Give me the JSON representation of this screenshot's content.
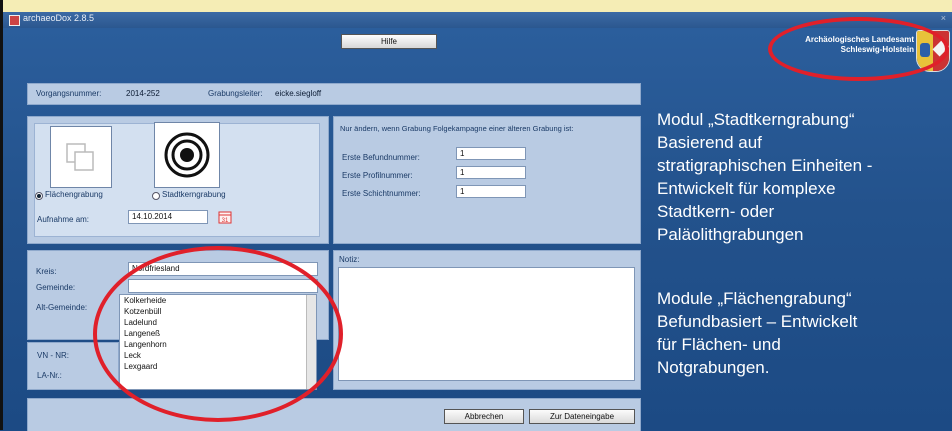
{
  "window": {
    "app_title": "archaeoDox 2.8.5",
    "close_glyph": "×"
  },
  "toolbar": {
    "help_label": "Hilfe"
  },
  "logo": {
    "line1": "Archäologisches Landesamt",
    "line2": "Schleswig-Holstein",
    "crest_icon": "coat-of-arms-icon"
  },
  "header": {
    "vorgang_label": "Vorgangsnummer:",
    "vorgang_value": "2014-252",
    "leiter_label": "Grabungsleiter:",
    "leiter_value": "eicke.siegloff"
  },
  "type": {
    "flaeche_label": "Flächengrabung",
    "stadtkern_label": "Stadtkerngrabung",
    "flaeche_icon": "overlapping-squares-icon",
    "stadtkern_icon": "concentric-circles-icon",
    "selected": "Flächengrabung",
    "date_label": "Aufnahme am:",
    "date_value": "14.10.2014",
    "calendar_icon": "calendar-icon"
  },
  "numbers": {
    "note": "Nur ändern, wenn Grabung Folgekampagne einer älteren Grabung ist:",
    "befund_label": "Erste Befundnummer:",
    "befund_value": "1",
    "profil_label": "Erste Profilnummer:",
    "profil_value": "1",
    "schicht_label": "Erste Schichtnummer:",
    "schicht_value": "1"
  },
  "location": {
    "kreis_label": "Kreis:",
    "kreis_value": "Nordfriesland",
    "gemeinde_label": "Gemeinde:",
    "gemeinde_value": "",
    "alt_label": "Alt-Gemeinde:",
    "vn_label": "VN - NR:",
    "la_label": "LA-Nr.:",
    "options": [
      "Kolkerheide",
      "Kotzenbüll",
      "Ladelund",
      "Langeneß",
      "Langenhorn",
      "Leck",
      "Lexgaard"
    ]
  },
  "notiz": {
    "label": "Notiz:",
    "value": ""
  },
  "footer": {
    "cancel_label": "Abbrechen",
    "next_label": "Zur Dateneingabe"
  },
  "annotation": {
    "heading1": "Modul „Stadtkerngrabung“",
    "lines1": [
      "Basierend auf",
      "stratigraphischen Einheiten -",
      "Entwickelt für komplexe",
      "Stadtkern- oder",
      "Paläolithgrabungen"
    ],
    "heading2": "Module „Flächengrabung“",
    "lines2": [
      "Befundbasiert – Entwickelt",
      "für Flächen- und",
      "Notgrabungen."
    ]
  },
  "colors": {
    "background": "#1b4b87",
    "panel": "#b9cbe3",
    "highlight_ellipse": "#e0202a",
    "top_band": "#f5edb5"
  }
}
